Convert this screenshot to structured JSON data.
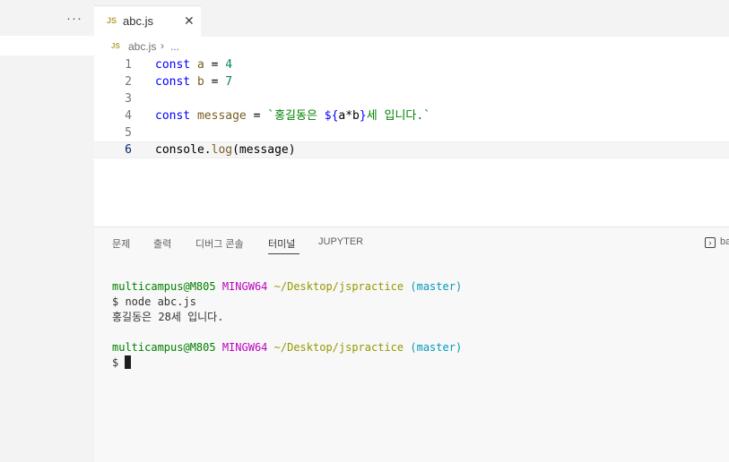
{
  "sidebar": {
    "more_actions": "···"
  },
  "tab": {
    "icon": "JS",
    "label": "abc.js",
    "close": "✕"
  },
  "breadcrumb": {
    "icon": "JS",
    "file": "abc.js",
    "separator": "›",
    "more": "..."
  },
  "editor": {
    "lines": [
      {
        "number": "1",
        "keyword": "const",
        "name": "a",
        "op": "=",
        "value": "4"
      },
      {
        "number": "2",
        "keyword": "const",
        "name": "b",
        "op": "=",
        "value": "7"
      },
      {
        "number": "3"
      },
      {
        "number": "4",
        "keyword": "const",
        "name": "message",
        "op": "=",
        "tpl_start": "`홍길동은 ",
        "tpl_open": "${",
        "tpl_expr": "a*b",
        "tpl_close": "}",
        "tpl_end": "세 입니다.`"
      },
      {
        "number": "5"
      },
      {
        "number": "6",
        "object": "console",
        "dot": ".",
        "method": "log",
        "args": "(message)"
      }
    ]
  },
  "panel": {
    "tabs": [
      "문제",
      "출력",
      "디버그 콘솔",
      "터미널",
      "JUPYTER"
    ],
    "active_tab": "터미널",
    "right_label": "ba"
  },
  "terminal": {
    "prompt1": {
      "user": "multicampus@M805",
      "host": "MINGW64",
      "path": "~/Desktop/jspractice",
      "branch": "(master)"
    },
    "command": "$ node abc.js",
    "output": "홍길동은 28세 입니다.",
    "prompt2": {
      "user": "multicampus@M805",
      "host": "MINGW64",
      "path": "~/Desktop/jspractice",
      "branch": "(master)"
    },
    "input_prompt": "$"
  }
}
